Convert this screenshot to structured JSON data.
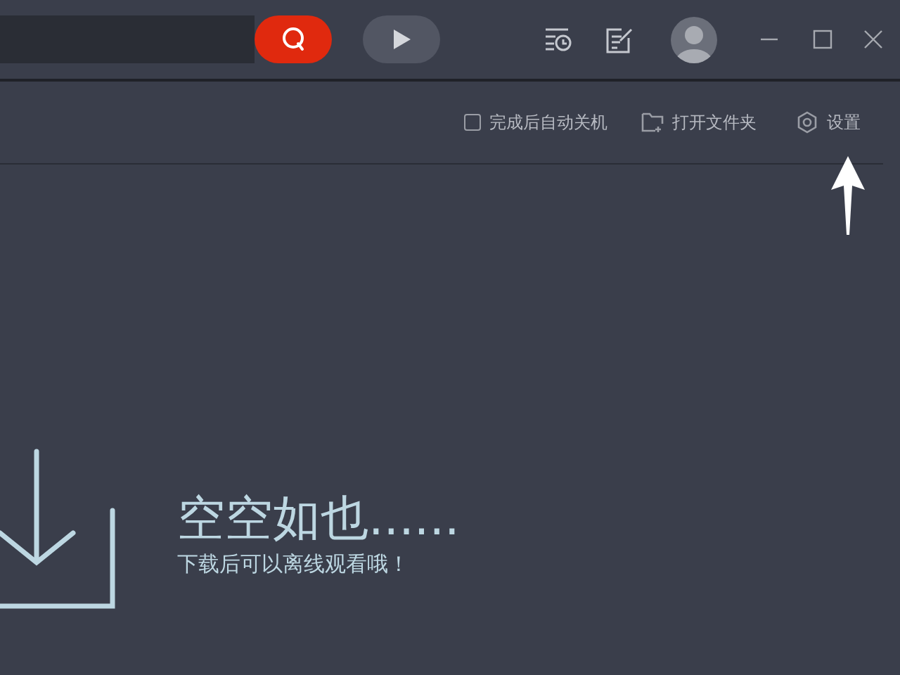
{
  "toolbar": {
    "shutdown_checkbox": {
      "label": "完成后自动关机",
      "checked": false
    },
    "open_folder": {
      "label": "打开文件夹"
    },
    "settings": {
      "label": "设置"
    }
  },
  "empty_state": {
    "title": "空空如也......",
    "subtitle": "下载后可以离线观看哦！"
  }
}
